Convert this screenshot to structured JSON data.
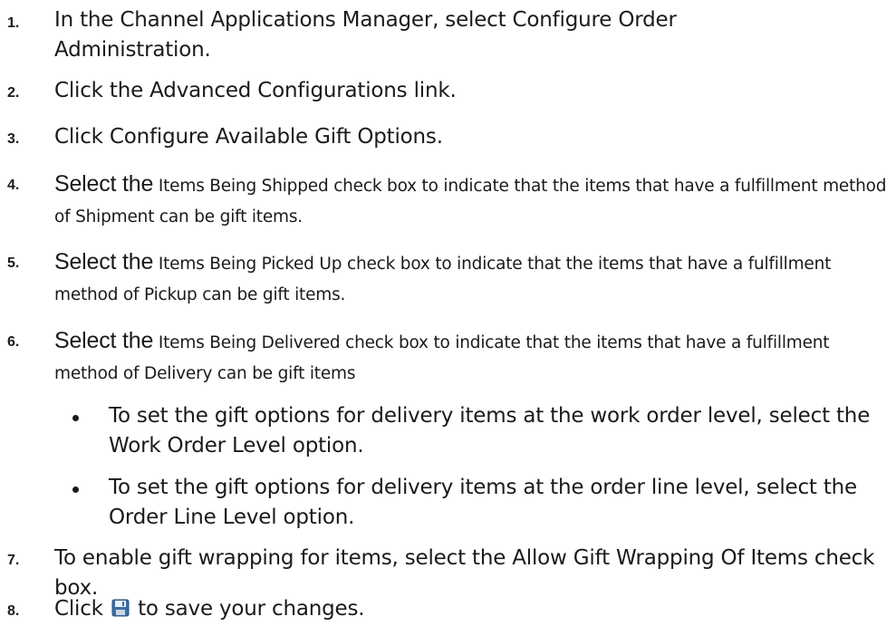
{
  "steps": [
    {
      "number": "1.",
      "text": "In the Channel Applications Manager, select Configure Order Administration."
    },
    {
      "number": "2.",
      "text": "Click the Advanced Configurations link."
    },
    {
      "number": "3.",
      "text": "Click Configure Available Gift Options."
    },
    {
      "number": "4.",
      "lead": "Select the",
      "term": "Items Being Shipped",
      "rest": "check box to indicate that the items that have a fulfillment method of Shipment can be gift items."
    },
    {
      "number": "5.",
      "lead": "Select the",
      "term": "Items Being Picked Up",
      "rest": "check box to indicate that the items that have a fulfillment method of Pickup can be gift items."
    },
    {
      "number": "6.",
      "lead": "Select the",
      "term": "Items Being Delivered",
      "rest": "check box to indicate that the items that have a fulfillment method of Delivery can be gift items"
    },
    {
      "number": "7.",
      "text": "To enable gift wrapping for items, select the Allow Gift Wrapping Of Items check box."
    },
    {
      "number": "8.",
      "before": "Click",
      "after": "to save your changes."
    }
  ],
  "sub_bullets": [
    "To set the gift options for delivery items at the work order level, select the Work Order Level option.",
    "To set the gift options for delivery items at the order line level, select the Order Line Level option."
  ],
  "icons": {
    "save": "floppy-disk-save-icon"
  },
  "colors": {
    "save_icon_body": "#3a6ea5",
    "save_icon_label": "#e8eef5"
  }
}
